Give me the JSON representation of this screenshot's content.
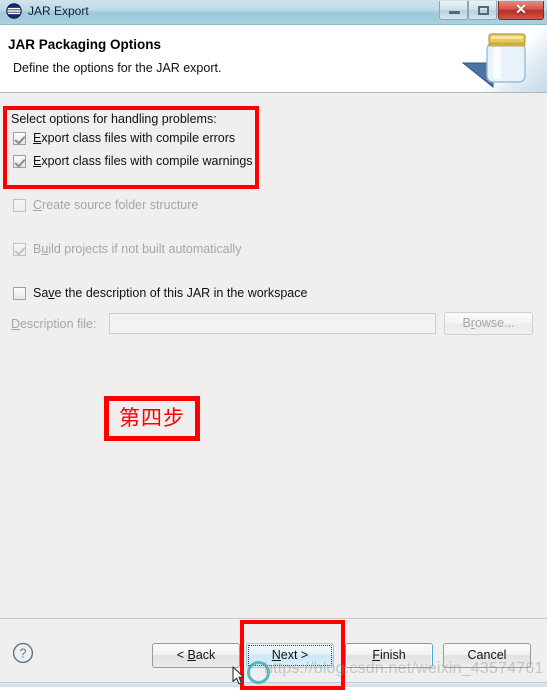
{
  "window": {
    "title": "JAR Export",
    "icon": "eclipse-icon",
    "controls": {
      "minimize": "–",
      "maximize": "□",
      "close": "✕"
    }
  },
  "header": {
    "title": "JAR Packaging Options",
    "description": "Define the options for the JAR export.",
    "banner_icon": "jar-icon"
  },
  "body": {
    "group_label": "Select options for handling problems:",
    "options": [
      {
        "label": "Export class files with compile errors",
        "mnemonic": "E",
        "checked": true,
        "enabled": true
      },
      {
        "label": "Export class files with compile warnings",
        "mnemonic": "E",
        "checked": true,
        "enabled": true
      },
      {
        "label": "Create source folder structure",
        "mnemonic": "C",
        "checked": false,
        "enabled": false
      },
      {
        "label": "Build projects if not built automatically",
        "mnemonic": "u",
        "checked": true,
        "enabled": false
      },
      {
        "label": "Save the description of this JAR in the workspace",
        "mnemonic": "v",
        "checked": false,
        "enabled": true
      }
    ],
    "description_file": {
      "label": "Description file:",
      "value": "",
      "placeholder": "",
      "browse_label": "Browse..."
    }
  },
  "annotations": {
    "step_text": "第四步",
    "box_color": "#fe0000"
  },
  "footer": {
    "help_label": "?",
    "buttons": [
      {
        "name": "back",
        "label": "< Back",
        "enabled": true,
        "default": false
      },
      {
        "name": "next",
        "label": "Next >",
        "enabled": true,
        "default": false
      },
      {
        "name": "finish",
        "label": "Finish",
        "enabled": true,
        "default": true
      },
      {
        "name": "cancel",
        "label": "Cancel",
        "enabled": true,
        "default": false
      }
    ]
  },
  "watermark": "https://blog.csdn.net/weixin_43574761"
}
